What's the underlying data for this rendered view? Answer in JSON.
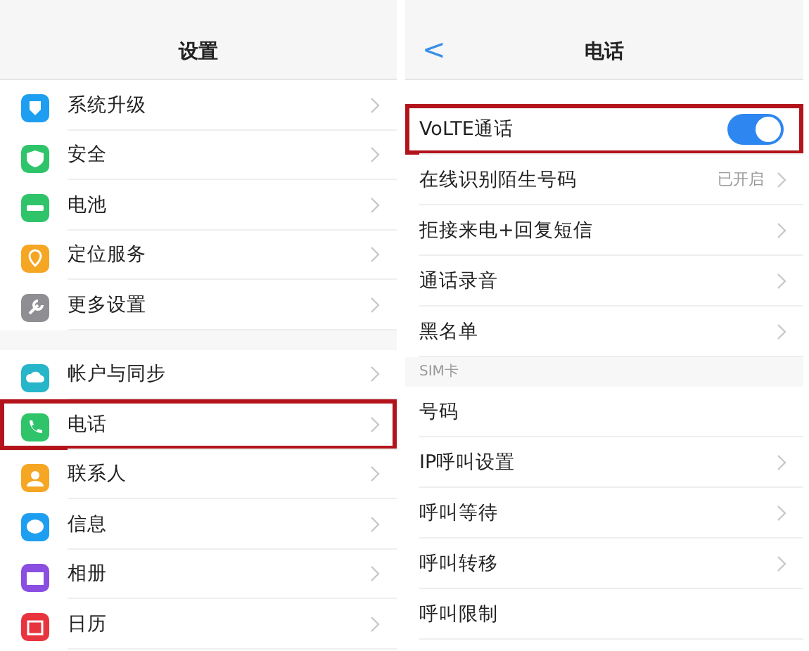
{
  "settings_screen": {
    "title": "设置",
    "groups": [
      [
        {
          "label": "系统升级",
          "color": "#1e9ef0",
          "highlighted": false
        },
        {
          "label": "安全",
          "color": "#2fc46a",
          "highlighted": false
        },
        {
          "label": "电池",
          "color": "#2fc46a",
          "highlighted": false
        },
        {
          "label": "定位服务",
          "color": "#f5a623",
          "highlighted": false
        },
        {
          "label": "更多设置",
          "color": "#8e8e93",
          "highlighted": false
        }
      ],
      [
        {
          "label": "帐户与同步",
          "color": "#26b5c9",
          "highlighted": false
        },
        {
          "label": "电话",
          "color": "#2fc46a",
          "highlighted": true
        },
        {
          "label": "联系人",
          "color": "#f5a623",
          "highlighted": false
        },
        {
          "label": "信息",
          "color": "#1e9ef0",
          "highlighted": false
        },
        {
          "label": "相册",
          "color": "#8a4fe0",
          "highlighted": false
        },
        {
          "label": "日历",
          "color": "#e8343e",
          "highlighted": false
        }
      ]
    ]
  },
  "phone_screen": {
    "back": "<",
    "title": "电话",
    "items": [
      {
        "kind": "toggle",
        "label": "VoLTE通话",
        "on": true,
        "highlighted": true
      },
      {
        "kind": "link",
        "label": "在线识别陌生号码",
        "value": "已开启",
        "highlighted": false
      },
      {
        "kind": "link",
        "label": "拒接来电+回复短信",
        "highlighted": false
      },
      {
        "kind": "link",
        "label": "通话录音",
        "highlighted": false
      },
      {
        "kind": "link",
        "label": "黑名单",
        "highlighted": false
      },
      {
        "kind": "section",
        "label": "SIM卡"
      },
      {
        "kind": "plain",
        "label": "号码",
        "highlighted": false
      },
      {
        "kind": "link",
        "label": "IP呼叫设置",
        "highlighted": false
      },
      {
        "kind": "link",
        "label": "呼叫等待",
        "highlighted": false
      },
      {
        "kind": "link",
        "label": "呼叫转移",
        "highlighted": false
      },
      {
        "kind": "plain",
        "label": "呼叫限制",
        "highlighted": false
      }
    ]
  }
}
